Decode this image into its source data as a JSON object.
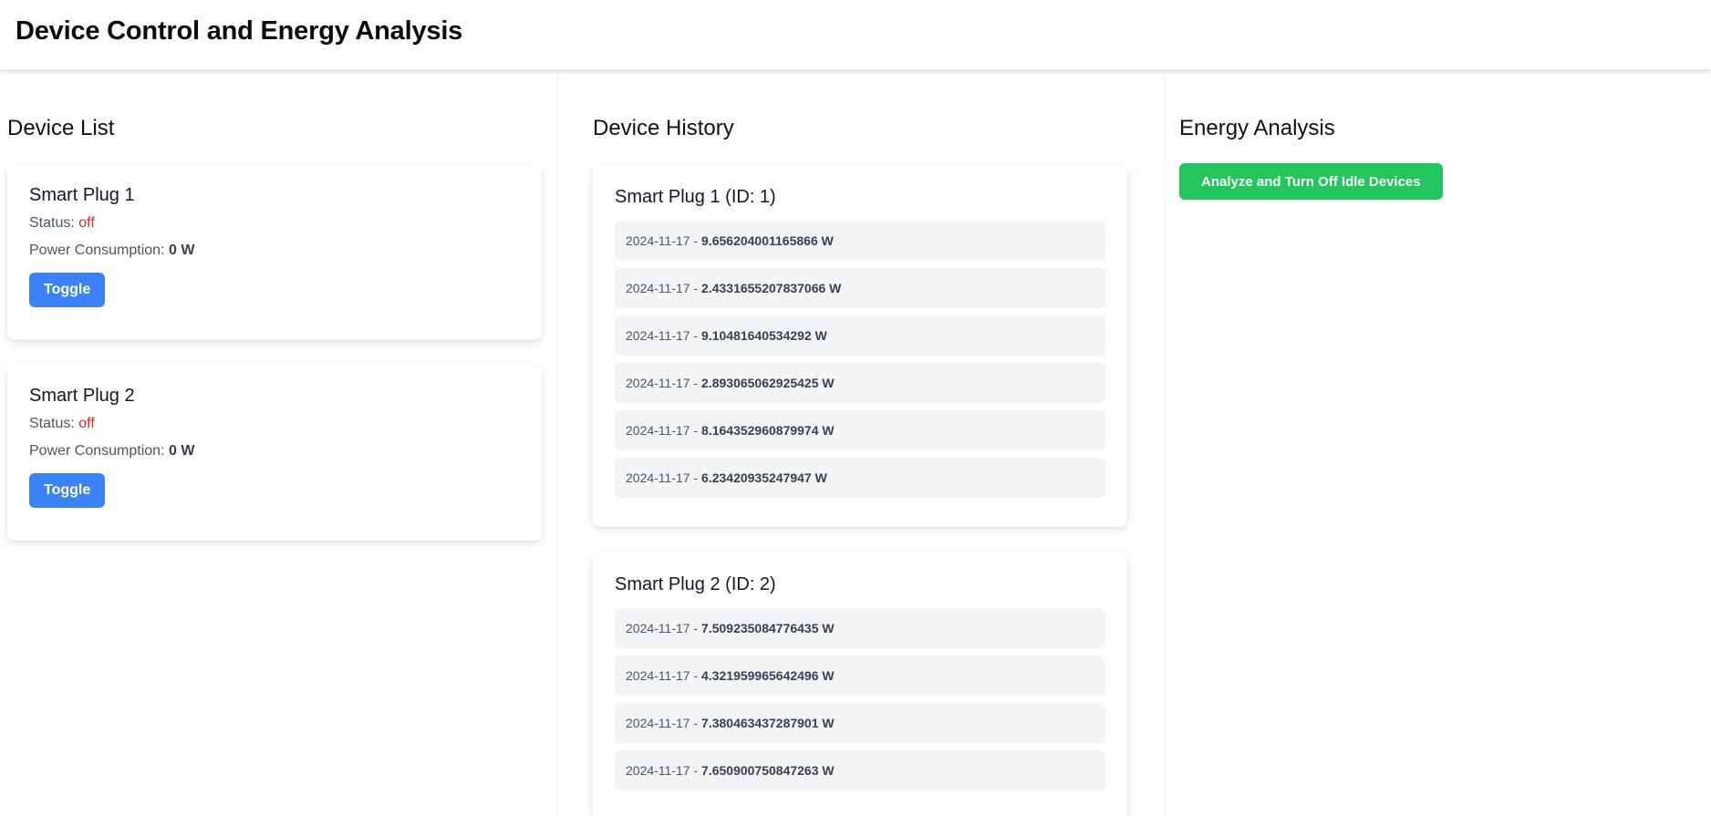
{
  "header": {
    "title": "Device Control and Energy Analysis"
  },
  "device_list": {
    "title": "Device List",
    "status_label": "Status:",
    "power_label": "Power Consumption:",
    "devices": [
      {
        "name": "Smart Plug 1",
        "status": "off",
        "power": "0 W",
        "toggle_label": "Toggle"
      },
      {
        "name": "Smart Plug 2",
        "status": "off",
        "power": "0 W",
        "toggle_label": "Toggle"
      }
    ]
  },
  "device_history": {
    "title": "Device History",
    "sep": " - ",
    "devices": [
      {
        "title": "Smart Plug 1 (ID: 1)",
        "entries": [
          {
            "date": "2024-11-17",
            "value": "9.656204001165866 W"
          },
          {
            "date": "2024-11-17",
            "value": "2.4331655207837066 W"
          },
          {
            "date": "2024-11-17",
            "value": "9.10481640534292 W"
          },
          {
            "date": "2024-11-17",
            "value": "2.893065062925425 W"
          },
          {
            "date": "2024-11-17",
            "value": "8.164352960879974 W"
          },
          {
            "date": "2024-11-17",
            "value": "6.23420935247947 W"
          }
        ]
      },
      {
        "title": "Smart Plug 2 (ID: 2)",
        "entries": [
          {
            "date": "2024-11-17",
            "value": "7.509235084776435 W"
          },
          {
            "date": "2024-11-17",
            "value": "4.321959965642496 W"
          },
          {
            "date": "2024-11-17",
            "value": "7.380463437287901 W"
          },
          {
            "date": "2024-11-17",
            "value": "7.650900750847263 W"
          }
        ]
      }
    ]
  },
  "energy_analysis": {
    "title": "Energy Analysis",
    "button_label": "Analyze and Turn Off Idle Devices"
  },
  "colors": {
    "toggle_button": "#3b82f6",
    "analyze_button": "#22c55e",
    "status_off": "#dc2626",
    "history_item_bg": "#f3f4f6"
  }
}
